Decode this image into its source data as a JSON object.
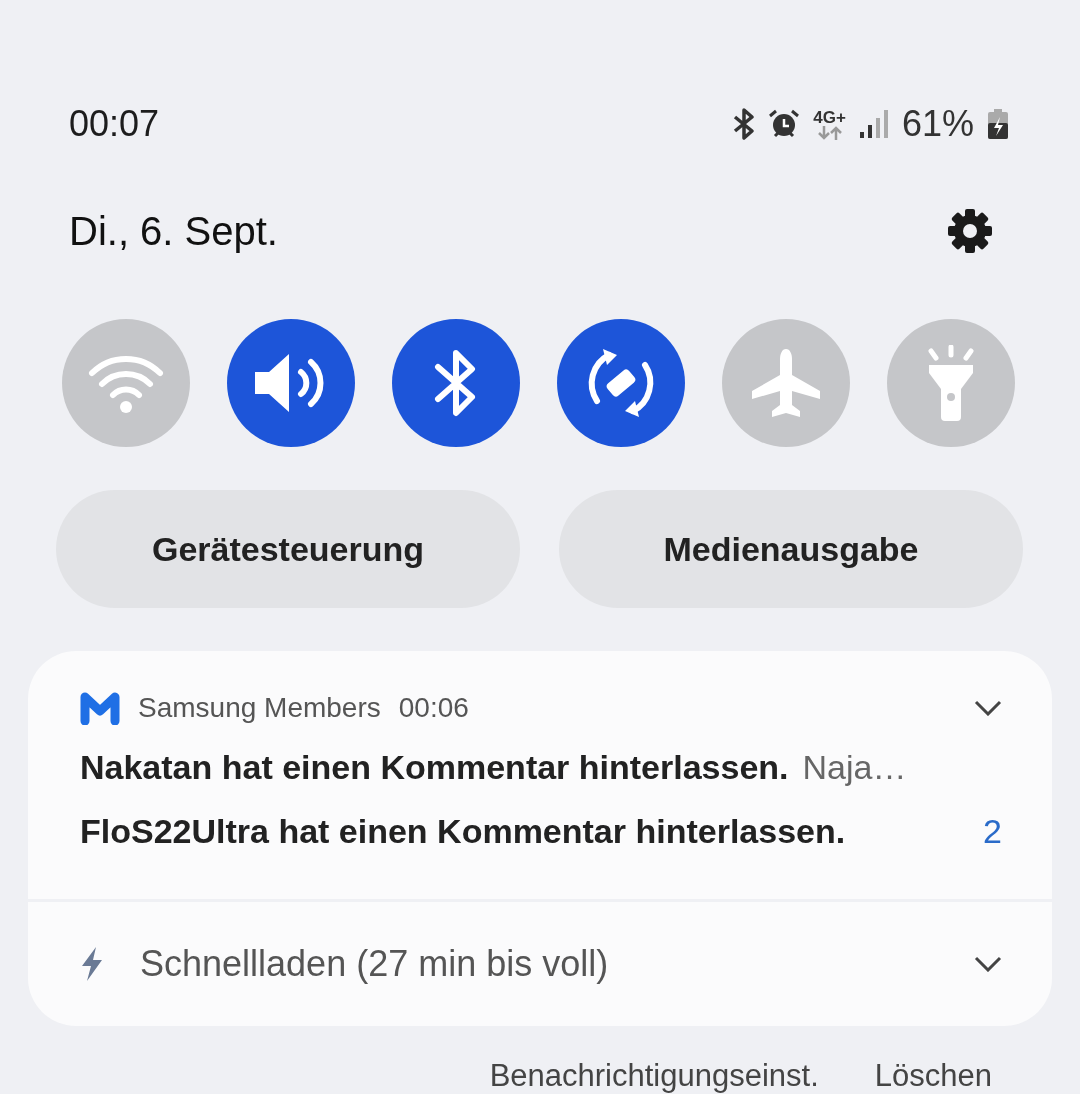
{
  "status_bar": {
    "time": "00:07",
    "network": "4G+",
    "battery": "61%"
  },
  "date": "Di., 6. Sept.",
  "quick_tiles": [
    {
      "kind": "wifi",
      "on": false
    },
    {
      "kind": "sound",
      "on": true
    },
    {
      "kind": "bluetooth",
      "on": true
    },
    {
      "kind": "rotation",
      "on": true
    },
    {
      "kind": "airplane",
      "on": false
    },
    {
      "kind": "flashlight",
      "on": false
    }
  ],
  "buttons": [
    "Gerätesteuerung",
    "Medienausgabe"
  ],
  "notifications": [
    {
      "kind": "app",
      "app": "Samsung Members",
      "time": "00:06",
      "messages": [
        {
          "text": "Nakatan hat einen Kommentar hinterlassen.",
          "preview": "Naja…"
        },
        {
          "text": "FloS22Ultra hat einen Kommentar hinterlassen.",
          "count": "2"
        }
      ]
    },
    {
      "kind": "charging",
      "text": "Schnellladen (27 min bis voll)"
    }
  ],
  "footer": [
    "Benachrichtigungseinst.",
    "Löschen"
  ]
}
